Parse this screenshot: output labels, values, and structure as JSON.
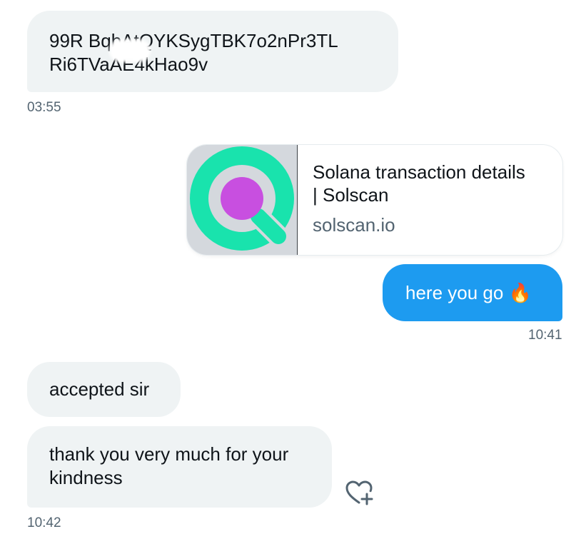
{
  "messages": [
    {
      "direction": "incoming",
      "lines": [
        "99R   BqbAtQYKSygTBK7o2nPr3TL",
        "Ri6TVaAE4kHao9v"
      ],
      "time": "03:55"
    },
    {
      "direction": "outgoing",
      "type": "link-card",
      "title_lines": [
        "Solana transaction details",
        "| Solscan"
      ],
      "domain": "solscan.io"
    },
    {
      "direction": "outgoing",
      "text": "here you go 🔥",
      "time": "10:41"
    },
    {
      "direction": "incoming",
      "text": "accepted sir"
    },
    {
      "direction": "incoming",
      "lines": [
        "thank you very much for your",
        "kindness"
      ],
      "time": "10:42"
    }
  ],
  "colors": {
    "incoming_bubble": "#eff3f4",
    "outgoing_bubble": "#1d9bf0",
    "timestamp": "#536471",
    "logo_teal": "#19e3ad",
    "logo_magenta": "#c84fe0"
  },
  "icons": {
    "reaction": "heart-plus-icon",
    "link_logo": "solscan-logo-icon"
  }
}
